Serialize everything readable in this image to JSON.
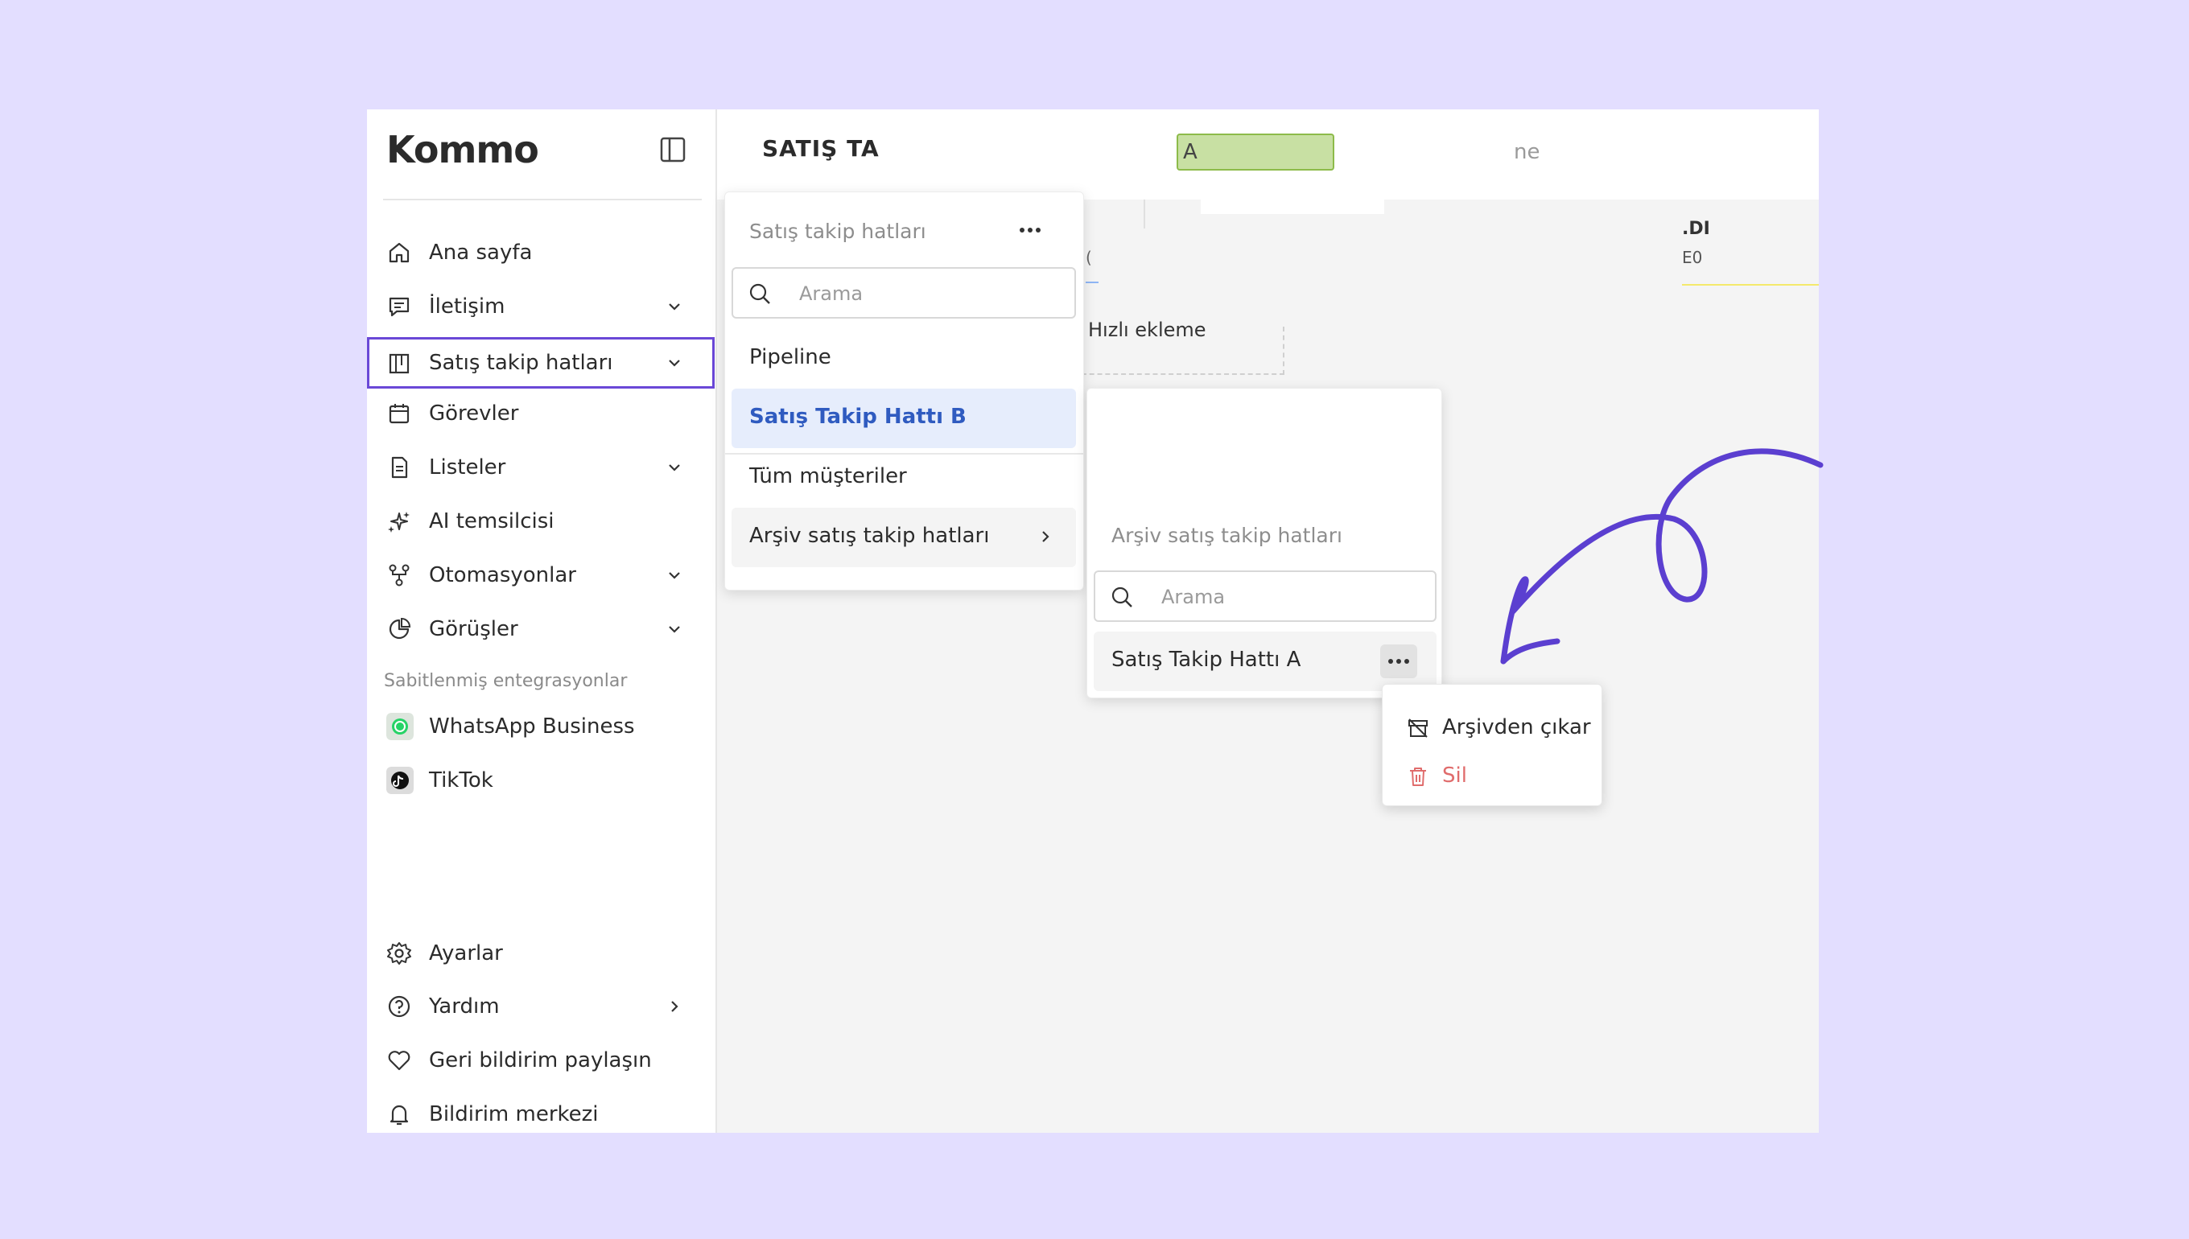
{
  "app": {
    "logo_text": "Kommo",
    "accent_color": "#6a48d7"
  },
  "sidebar": {
    "items": [
      {
        "label": "Ana sayfa",
        "icon": "home-icon"
      },
      {
        "label": "İletişim",
        "icon": "chat-icon"
      },
      {
        "label": "Satış takip hatları",
        "icon": "pipeline-icon"
      },
      {
        "label": "Görevler",
        "icon": "calendar-icon"
      },
      {
        "label": "Listeler",
        "icon": "document-icon"
      },
      {
        "label": "AI temsilcisi",
        "icon": "sparkle-icon"
      },
      {
        "label": "Otomasyonlar",
        "icon": "automation-icon"
      },
      {
        "label": "Görüşler",
        "icon": "pie-chart-icon"
      }
    ],
    "pinned_label": "Sabitlenmiş entegrasyonlar",
    "integrations": [
      {
        "label": "WhatsApp Business",
        "icon": "whatsapp-icon"
      },
      {
        "label": "TikTok",
        "icon": "tiktok-icon"
      }
    ],
    "footer_items": [
      {
        "label": "Ayarlar",
        "icon": "gear-icon"
      },
      {
        "label": "Yardım",
        "icon": "help-icon"
      },
      {
        "label": "Geri bildirim paylaşın",
        "icon": "heart-icon"
      },
      {
        "label": "Bildirim merkezi",
        "icon": "bell-icon"
      }
    ]
  },
  "topbar": {
    "title": "SATIŞ TA",
    "green_fragment": "A",
    "right_fragment": "ne"
  },
  "board": {
    "column_title_fragment": ".DI",
    "column_sub_fragment": "E0",
    "column_c_fragment": "(",
    "quick_add": "Hızlı ekleme"
  },
  "pipelines_panel": {
    "header": "Satış takip hatları",
    "search_placeholder": "Arama",
    "items": [
      "Pipeline",
      "Satış Takip Hattı B"
    ],
    "all_clients": "Tüm müşteriler",
    "archive": "Arşiv satış takip hatları"
  },
  "archive_panel": {
    "header": "Arşiv satış takip hatları",
    "search_placeholder": "Arama",
    "items": [
      "Satış Takip Hattı A"
    ]
  },
  "context_menu": {
    "items": [
      {
        "label": "Arşivden çıkar",
        "icon": "unarchive-icon"
      },
      {
        "label": "Sil",
        "icon": "trash-icon",
        "color": "#e06c6c"
      }
    ]
  }
}
